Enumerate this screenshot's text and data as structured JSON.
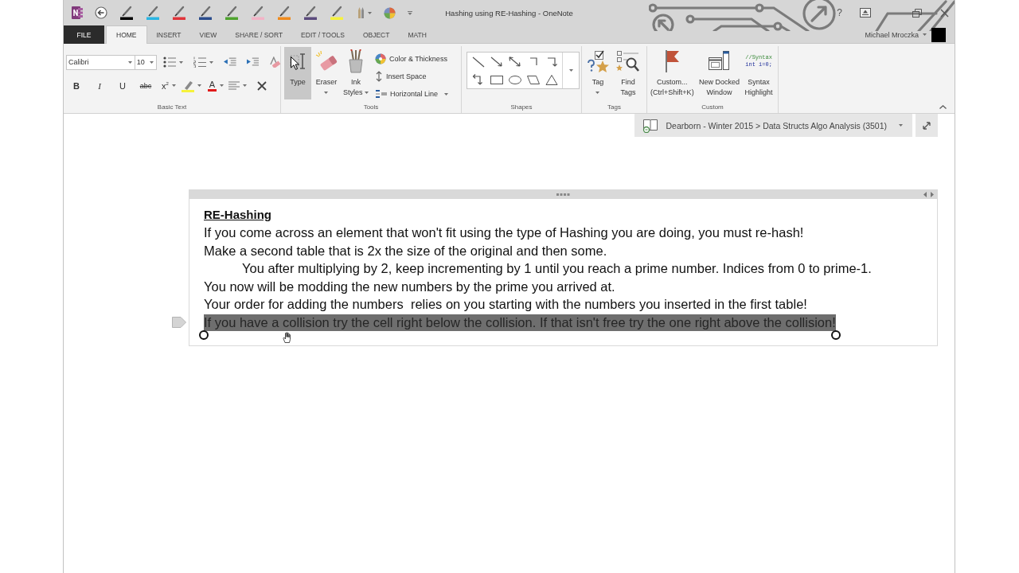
{
  "window": {
    "title": "Hashing using RE-Hashing - OneNote",
    "help": "?"
  },
  "quick_access": {
    "pens": [
      {
        "color": "#000000"
      },
      {
        "color": "#29b5e3"
      },
      {
        "color": "#e0343a"
      },
      {
        "color": "#2a4c8c"
      },
      {
        "color": "#4fa32e"
      },
      {
        "color": "#f3b3c6"
      },
      {
        "color": "#ef8a1d"
      },
      {
        "color": "#5b4b7d"
      },
      {
        "color": "#f6f23c"
      }
    ]
  },
  "tabs": [
    {
      "label": "FILE",
      "kind": "backstage",
      "selected": false
    },
    {
      "label": "HOME",
      "kind": "tab",
      "selected": true
    },
    {
      "label": "INSERT",
      "kind": "tab",
      "selected": false
    },
    {
      "label": "VIEW",
      "kind": "tab",
      "selected": false
    },
    {
      "label": "SHARE / SORT",
      "kind": "tab",
      "selected": false
    },
    {
      "label": "EDIT / TOOLS",
      "kind": "tab",
      "selected": false
    },
    {
      "label": "OBJECT",
      "kind": "tab",
      "selected": false
    },
    {
      "label": "MATH",
      "kind": "tab",
      "selected": false
    }
  ],
  "account": {
    "user": "Michael Mroczka"
  },
  "ribbon": {
    "groups": [
      {
        "label": "Basic Text",
        "kind": "basic_text",
        "font": "Calibri",
        "size": "10",
        "format_buttons": [
          {
            "label": "B",
            "kind": "bold"
          },
          {
            "label": "I",
            "kind": "italic"
          },
          {
            "label": "U",
            "kind": "underline"
          },
          {
            "label": "abc",
            "kind": "strike"
          },
          {
            "label": "x$^{2}$",
            "kind": "superscript"
          },
          {
            "label": "A",
            "kind": "font_color"
          }
        ]
      },
      {
        "label": "Tools",
        "kind": "tools",
        "buttons": [
          {
            "label": "Type",
            "kind": "type",
            "selected": true,
            "dropdown": false
          },
          {
            "label": "Eraser",
            "kind": "eraser",
            "selected": false,
            "dropdown": true
          },
          {
            "label": "Ink\nStyles",
            "kind": "ink_styles",
            "selected": false,
            "dropdown": true
          }
        ],
        "small_buttons": [
          {
            "label": "Color & Thickness",
            "kind": "color_thickness",
            "dropdown": false
          },
          {
            "label": "Insert Space",
            "kind": "insert_space",
            "dropdown": false
          },
          {
            "label": "Horizontal Line",
            "kind": "horizontal_line",
            "dropdown": true
          }
        ]
      },
      {
        "label": "Shapes",
        "kind": "shapes"
      },
      {
        "label": "Tags",
        "kind": "commands",
        "buttons": [
          {
            "label": "Tag",
            "kind": "tag",
            "dropdown": true
          },
          {
            "label": "Find\nTags",
            "kind": "find_tags",
            "dropdown": false
          }
        ]
      },
      {
        "label": "Custom",
        "kind": "commands",
        "buttons": [
          {
            "label": "Custom...\n(Ctrl+Shift+K)",
            "kind": "custom",
            "dropdown": false
          },
          {
            "label": "New Docked\nWindow",
            "kind": "docked_window",
            "dropdown": false
          },
          {
            "label": "Syntax\nHighlight",
            "kind": "syntax_highlight",
            "dropdown": false,
            "code_lines": [
              "//Syntax",
              "int i=0;"
            ]
          }
        ]
      }
    ]
  },
  "notebook": {
    "breadcrumb": "Dearborn - Winter 2015 > Data Structs Algo Analysis (3501)"
  },
  "note": {
    "title": "RE-Hashing",
    "paragraphs": [
      {
        "text": "If you come across an element that won't fit using the type of Hashing you are doing, you must re-hash!",
        "selected": false
      },
      {
        "text": "Make a second table that is 2x the size of the original and then some.",
        "selected": false,
        "children": [
          {
            "text": "You after multiplying by 2, keep incrementing by 1 until you reach a prime number. Indices from 0 to prime-1.",
            "selected": false
          }
        ]
      },
      {
        "text": "You now will be modding the new numbers by the prime you arrived at.",
        "selected": false
      },
      {
        "text": "Your order for adding the numbers  relies on you starting with the numbers you inserted in the first table!",
        "selected": false
      },
      {
        "text": "If you have a collision try the cell right below the collision. If that isn't free try the one right above the collision!",
        "selected": true
      }
    ]
  }
}
